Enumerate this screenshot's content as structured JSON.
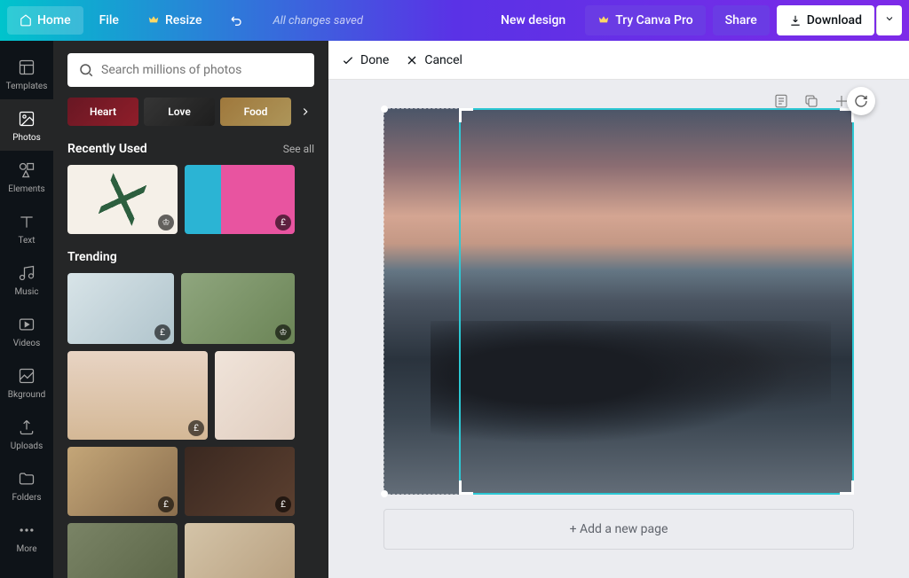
{
  "header": {
    "home": "Home",
    "file": "File",
    "resize": "Resize",
    "status": "All changes saved",
    "new_design": "New design",
    "try_pro": "Try Canva Pro",
    "share": "Share",
    "download": "Download"
  },
  "rail": {
    "items": [
      {
        "label": "Templates"
      },
      {
        "label": "Photos"
      },
      {
        "label": "Elements"
      },
      {
        "label": "Text"
      },
      {
        "label": "Music"
      },
      {
        "label": "Videos"
      },
      {
        "label": "Bkground"
      },
      {
        "label": "Uploads"
      },
      {
        "label": "Folders"
      },
      {
        "label": "More"
      }
    ]
  },
  "panel": {
    "search_placeholder": "Search millions of photos",
    "categories": [
      {
        "label": "Heart"
      },
      {
        "label": "Love"
      },
      {
        "label": "Food"
      }
    ],
    "recently_used": {
      "title": "Recently Used",
      "see_all": "See all"
    },
    "trending": {
      "title": "Trending"
    }
  },
  "crop": {
    "done": "Done",
    "cancel": "Cancel"
  },
  "stage": {
    "add_page": "+ Add a new page"
  }
}
